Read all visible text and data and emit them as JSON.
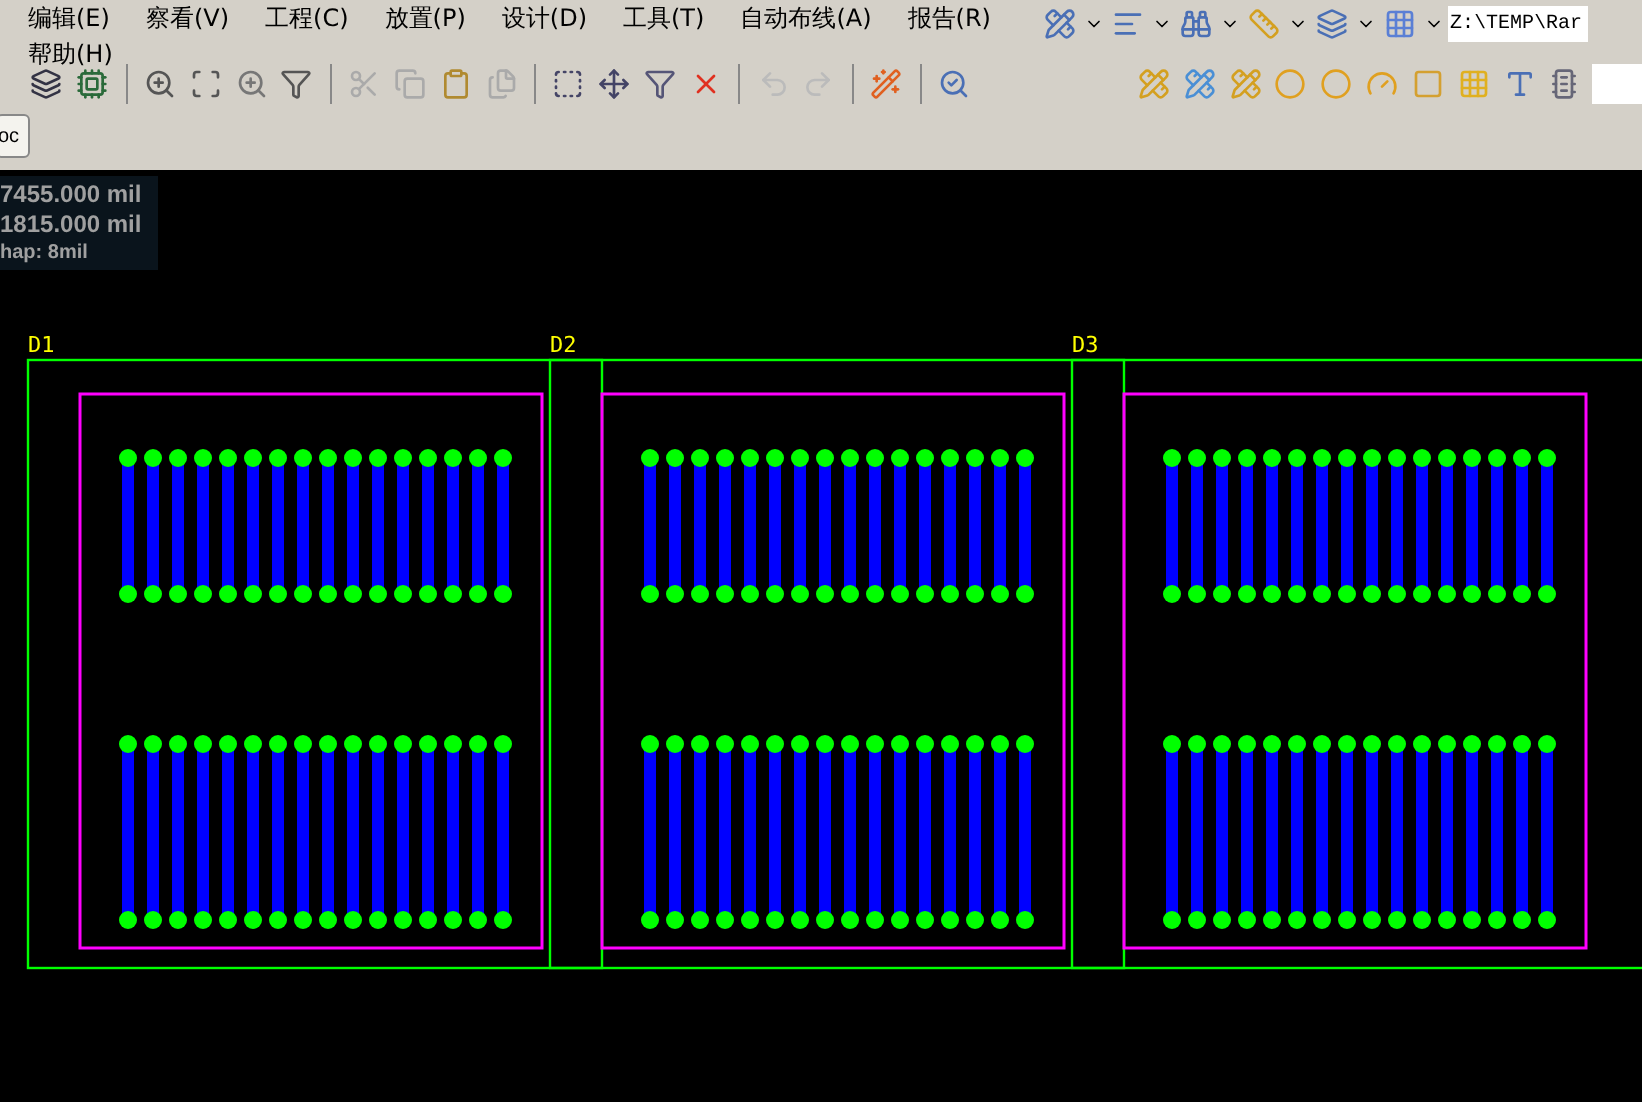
{
  "menu": [
    "编辑(E)",
    "察看(V)",
    "工程(C)",
    "放置(P)",
    "设计(D)",
    "工具(T)",
    "自动布线(A)",
    "报告(R)",
    "帮助(H)"
  ],
  "path_field": {
    "value": "Z:\\TEMP\\Rar"
  },
  "doc_tab": {
    "label": "oc"
  },
  "coordinates": [
    "7455.000 mil",
    "1815.000 mil",
    "hap: 8mil"
  ],
  "components": [
    {
      "designator": "D1"
    },
    {
      "designator": "D2"
    },
    {
      "designator": "D3"
    }
  ]
}
